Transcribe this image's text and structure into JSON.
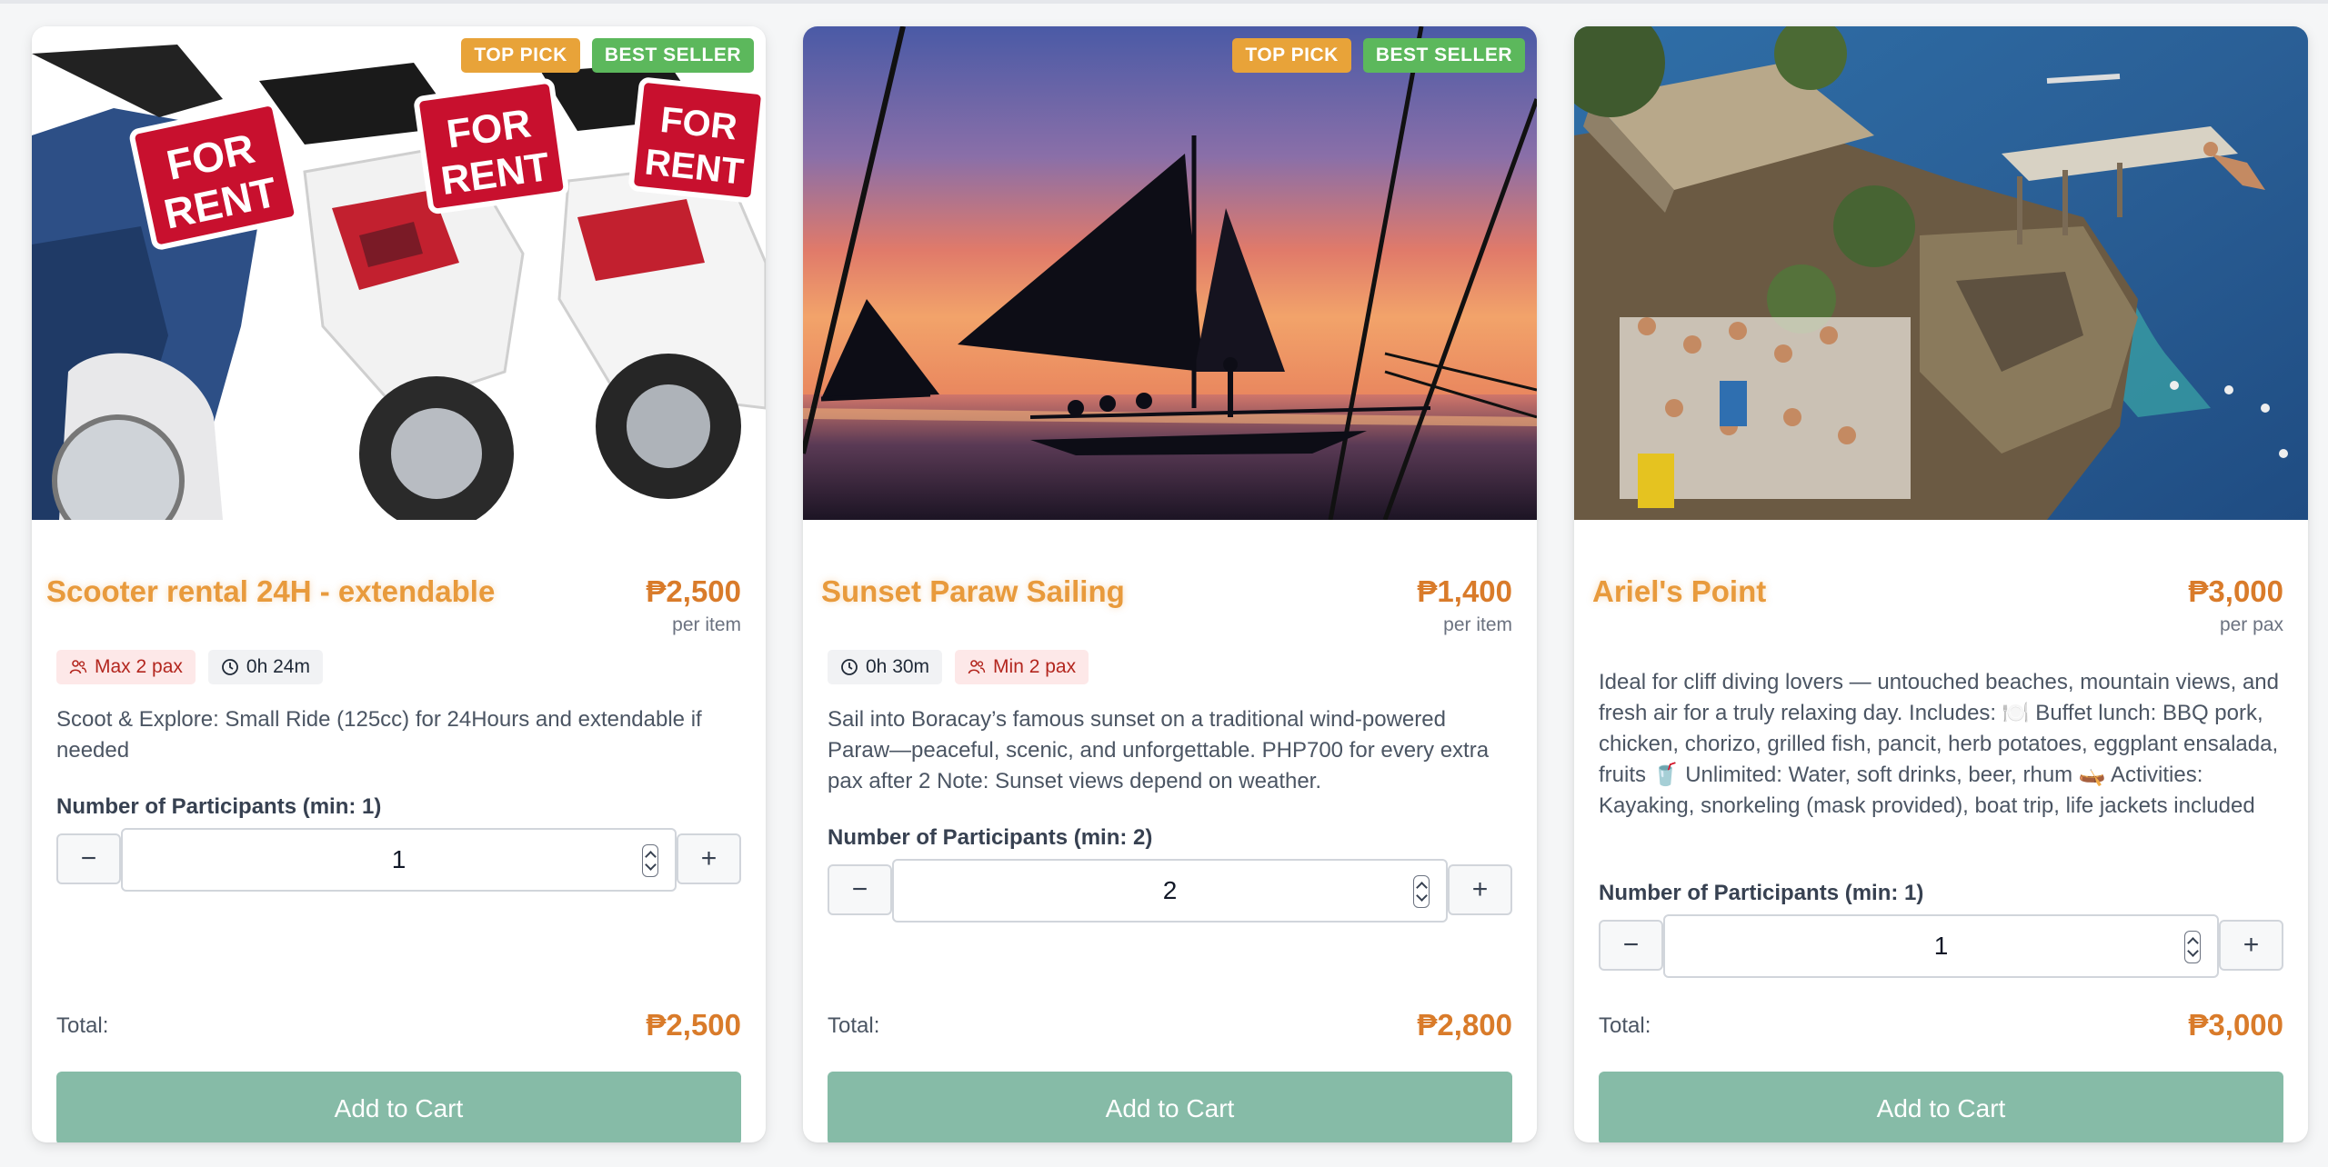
{
  "badges": {
    "top_pick": "TOP PICK",
    "best_seller": "BEST SELLER"
  },
  "colors": {
    "accent": "#e89a3c",
    "price": "#d97b2a",
    "button": "#86bba7",
    "top_pick": "#e8a339",
    "best_seller": "#5cb85c"
  },
  "cards": [
    {
      "title": "Scooter rental 24H - extendable",
      "price": "₱2,500",
      "price_unit": "per item",
      "tags": [
        {
          "icon": "users-icon",
          "text": "Max 2 pax"
        },
        {
          "icon": "clock-icon",
          "text": "0h 24m"
        }
      ],
      "description": "Scoot & Explore: Small Ride (125cc) for 24Hours and extendable if needed",
      "participants_label": "Number of Participants (min: 1)",
      "quantity": "1",
      "total_label": "Total:",
      "total": "₱2,500",
      "cta": "Add to Cart",
      "image_text": [
        "FOR",
        "RENT"
      ]
    },
    {
      "title": "Sunset Paraw Sailing",
      "price": "₱1,400",
      "price_unit": "per item",
      "tags": [
        {
          "icon": "clock-icon",
          "text": "0h 30m"
        },
        {
          "icon": "users-icon",
          "text": "Min 2 pax"
        }
      ],
      "description": "Sail into Boracay’s famous sunset on a traditional wind-powered Paraw—peaceful, scenic, and unforgettable. PHP700 for every extra pax after 2 Note: Sunset views depend on weather.",
      "participants_label": "Number of Participants (min: 2)",
      "quantity": "2",
      "total_label": "Total:",
      "total": "₱2,800",
      "cta": "Add to Cart"
    },
    {
      "title": "Ariel's Point",
      "price": "₱3,000",
      "price_unit": "per pax",
      "description": "Ideal for cliff diving lovers — untouched beaches, mountain views, and fresh air for a truly relaxing day. Includes: 🍽️ Buffet lunch: BBQ pork, chicken, chorizo, grilled fish, pancit, herb potatoes, eggplant ensalada, fruits 🥤 Unlimited: Water, soft drinks, beer, rhum 🛶 Activities: Kayaking, snorkeling (mask provided), boat trip, life jackets included",
      "participants_label": "Number of Participants (min: 1)",
      "quantity": "1",
      "total_label": "Total:",
      "total": "₱3,000",
      "cta": "Add to Cart"
    }
  ]
}
